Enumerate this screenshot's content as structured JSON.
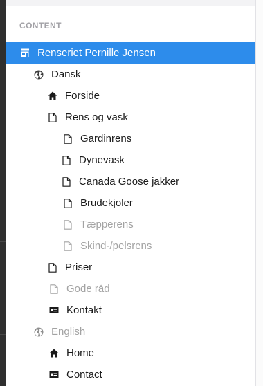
{
  "section": {
    "title": "CONTENT"
  },
  "tree": {
    "root": {
      "label": "Renseriet Pernille Jensen",
      "icon": "store-icon"
    },
    "dansk": {
      "label": "Dansk",
      "icon": "globe-icon"
    },
    "forside": {
      "label": "Forside",
      "icon": "home-icon"
    },
    "rens_og_vask": {
      "label": "Rens og vask",
      "icon": "document-icon"
    },
    "gardinrens": {
      "label": "Gardinrens",
      "icon": "document-icon"
    },
    "dynevask": {
      "label": "Dynevask",
      "icon": "document-icon"
    },
    "canada_goose": {
      "label": "Canada Goose jakker",
      "icon": "document-icon"
    },
    "brudekjoler": {
      "label": "Brudekjoler",
      "icon": "document-icon"
    },
    "taepperens": {
      "label": "Tæpperens",
      "icon": "document-icon"
    },
    "skind_pelsrens": {
      "label": "Skind-/pelsrens",
      "icon": "document-icon"
    },
    "priser": {
      "label": "Priser",
      "icon": "document-icon"
    },
    "gode_raad": {
      "label": "Gode råd",
      "icon": "document-icon"
    },
    "kontakt": {
      "label": "Kontakt",
      "icon": "contact-card-icon"
    },
    "english": {
      "label": "English",
      "icon": "globe-icon"
    },
    "home": {
      "label": "Home",
      "icon": "home-icon"
    },
    "contact": {
      "label": "Contact",
      "icon": "contact-card-icon"
    }
  },
  "colors": {
    "selected_background": "#2d8ceb",
    "selected_text": "#ffffff",
    "muted_text": "#a3a3a3",
    "section_header": "#a2a1a6"
  }
}
